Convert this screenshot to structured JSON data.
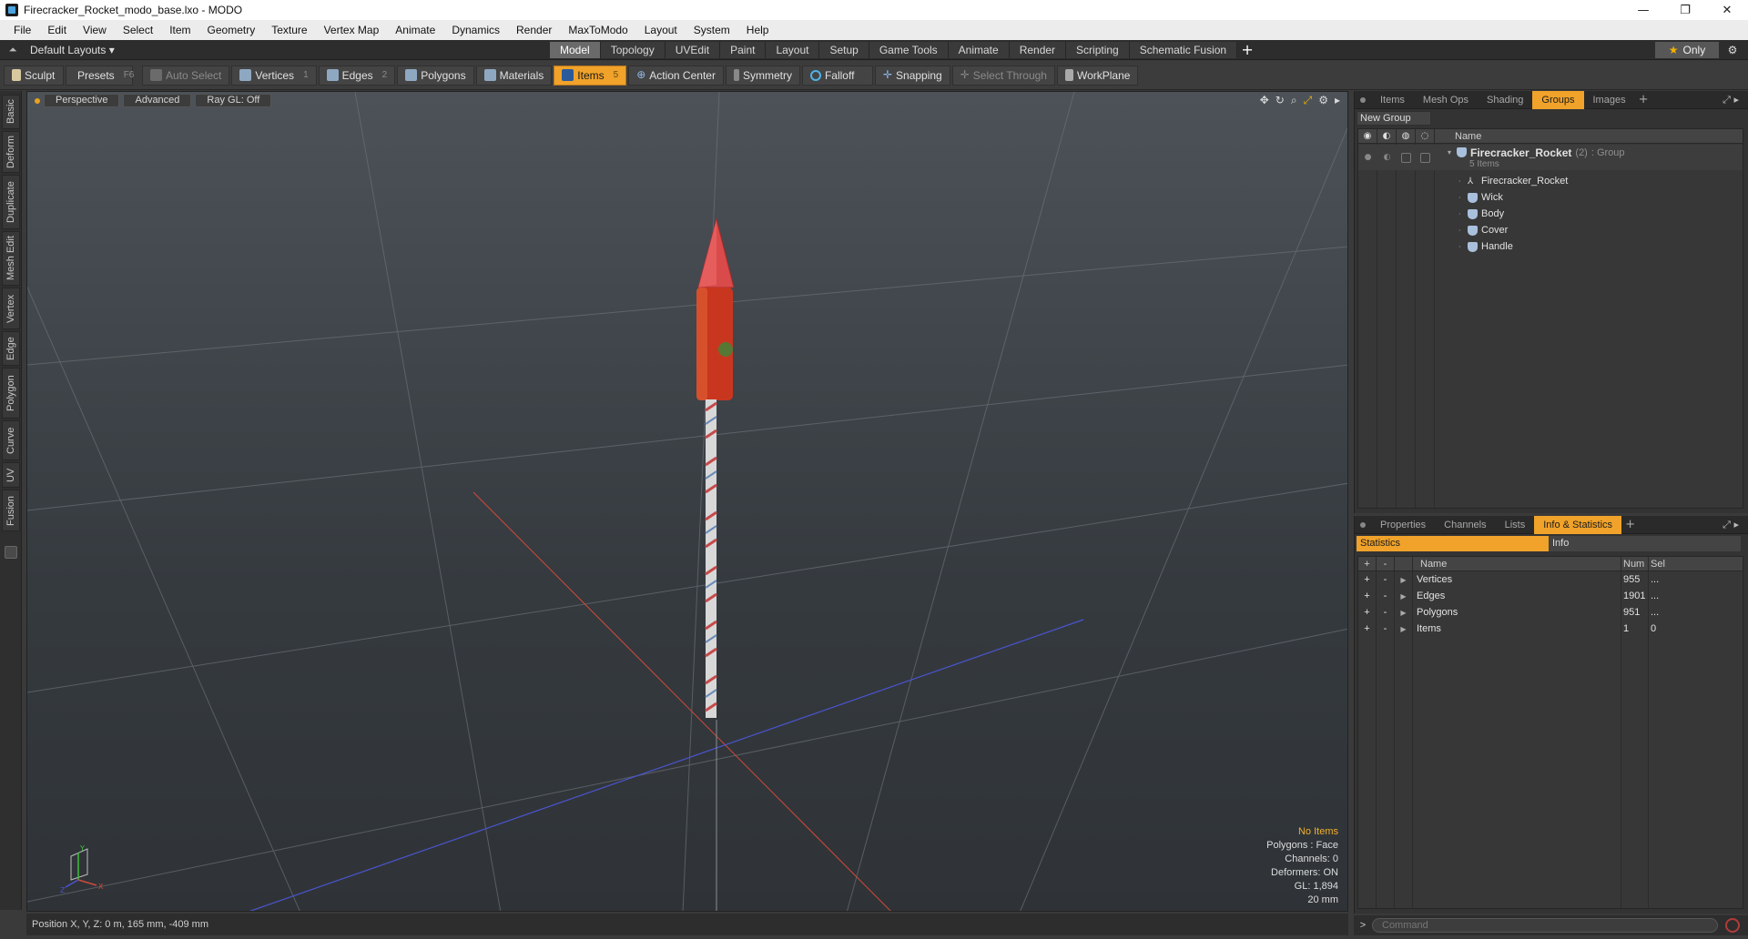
{
  "window": {
    "title": "Firecracker_Rocket_modo_base.lxo - MODO",
    "minimize": "—",
    "maximize": "❐",
    "close": "✕"
  },
  "menu": [
    "File",
    "Edit",
    "View",
    "Select",
    "Item",
    "Geometry",
    "Texture",
    "Vertex Map",
    "Animate",
    "Dynamics",
    "Render",
    "MaxToModo",
    "Layout",
    "System",
    "Help"
  ],
  "layoutbar": {
    "layout_select": "Default Layouts ▾",
    "tabs": [
      "Model",
      "Topology",
      "UVEdit",
      "Paint",
      "Layout",
      "Setup",
      "Game Tools",
      "Animate",
      "Render",
      "Scripting",
      "Schematic Fusion"
    ],
    "active_tab": "Model",
    "add_tab": "+",
    "only_label": "Only",
    "only_icon": "★",
    "gear": "⚙"
  },
  "toolbar": {
    "sculpt": "Sculpt",
    "presets": "Presets",
    "presets_key": "F6",
    "auto_select": "Auto Select",
    "vertices": "Vertices",
    "vertices_key": "1",
    "edges": "Edges",
    "edges_key": "2",
    "polygons": "Polygons",
    "materials": "Materials",
    "items": "Items",
    "items_key": "5",
    "action_center": "Action Center",
    "symmetry": "Symmetry",
    "falloff": "Falloff",
    "snapping": "Snapping",
    "select_through": "Select Through",
    "workplane": "WorkPlane"
  },
  "left_tabs": [
    "Basic",
    "Deform",
    "Duplicate",
    "Mesh Edit",
    "Vertex",
    "Edge",
    "Polygon",
    "Curve",
    "UV",
    "Fusion"
  ],
  "viewport": {
    "view": "Perspective",
    "shading": "Advanced",
    "raygl": "Ray GL: Off",
    "tools": [
      "✥",
      "↻",
      "⌕",
      "⤢",
      "⚙",
      "▸"
    ],
    "info": {
      "selection": "No Items",
      "polygons": "Polygons : Face",
      "channels": "Channels: 0",
      "deformers": "Deformers: ON",
      "gl": "GL: 1,894",
      "scale": "20 mm"
    },
    "axis": {
      "x": "X",
      "y": "Y",
      "z": "Z"
    }
  },
  "statusbar": {
    "position": "Position X, Y, Z:  0 m, 165 mm, -409 mm"
  },
  "groups_panel": {
    "tabs": [
      "Items",
      "Mesh Ops",
      "Shading",
      "Groups",
      "Images"
    ],
    "active_tab": "Groups",
    "add_tab": "+",
    "new_group": "New Group",
    "column_name": "Name",
    "group": {
      "name": "Firecracker_Rocket",
      "count": "(2)",
      "type": ": Group",
      "sub": "5 Items"
    },
    "children": [
      {
        "name": "Firecracker_Rocket",
        "icon": "locator-icon"
      },
      {
        "name": "Wick",
        "icon": "mesh-icon"
      },
      {
        "name": "Body",
        "icon": "mesh-icon"
      },
      {
        "name": "Cover",
        "icon": "mesh-icon"
      },
      {
        "name": "Handle",
        "icon": "mesh-icon"
      }
    ]
  },
  "info_panel": {
    "tabs": [
      "Properties",
      "Channels",
      "Lists",
      "Info & Statistics"
    ],
    "active_tab": "Info & Statistics",
    "add_tab": "+",
    "sub_tabs": [
      "Statistics",
      "Info"
    ],
    "columns": {
      "plus": "+",
      "minus": "-",
      "name": "Name",
      "num": "Num",
      "sel": "Sel"
    },
    "rows": [
      {
        "plus": "+",
        "minus": "-",
        "name": "Vertices",
        "num": "955",
        "sel": "..."
      },
      {
        "plus": "+",
        "minus": "-",
        "name": "Edges",
        "num": "1901",
        "sel": "..."
      },
      {
        "plus": "+",
        "minus": "-",
        "name": "Polygons",
        "num": "951",
        "sel": "..."
      },
      {
        "plus": "+",
        "minus": "-",
        "name": "Items",
        "num": "1",
        "sel": "0"
      }
    ]
  },
  "command": {
    "prompt": ">",
    "placeholder": "Command"
  },
  "colors": {
    "accent": "#f0a22a",
    "viewport_top": "#4c5258",
    "viewport_bottom": "#2f3337",
    "axis_x": "#d04a3a",
    "axis_z": "#4a55d0",
    "rocket_red": "#d23a2a"
  }
}
